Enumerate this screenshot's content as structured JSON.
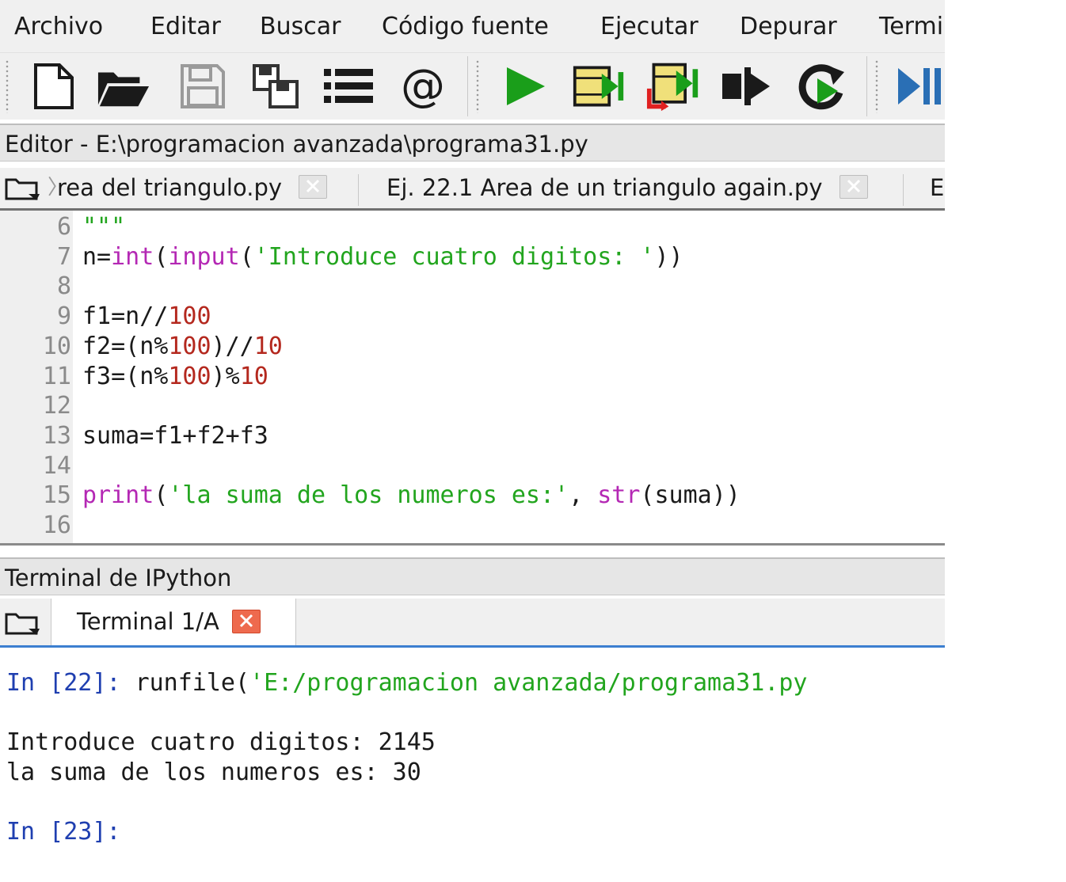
{
  "menubar": {
    "items": [
      "Archivo",
      "Editar",
      "Buscar",
      "Código fuente",
      "Ejecutar",
      "Depurar",
      "Termi"
    ]
  },
  "toolbar": {
    "buttons": [
      {
        "name": "new-file-icon"
      },
      {
        "name": "open-folder-icon"
      },
      {
        "name": "save-icon"
      },
      {
        "name": "save-all-icon"
      },
      {
        "name": "list-icon"
      },
      {
        "name": "at-icon"
      },
      {
        "name": "run-icon"
      },
      {
        "name": "run-cell-icon"
      },
      {
        "name": "run-cell-advance-icon"
      },
      {
        "name": "run-selection-icon"
      },
      {
        "name": "rerun-icon"
      },
      {
        "name": "debug-icon"
      }
    ],
    "colors": {
      "run": "#1a9e1a",
      "cell": "#f0e07a",
      "debug": "#2a6fb5"
    }
  },
  "editor": {
    "title": "Editor - E:\\programacion avanzada\\programa31.py",
    "tabs": [
      {
        "label": "rea del triangulo.py"
      },
      {
        "label": "Ej. 22.1 Area de un triangulo again.py"
      },
      {
        "label": "E"
      }
    ],
    "lines": [
      {
        "n": "6",
        "tokens": [
          {
            "t": "\"\"\"",
            "c": "cm"
          }
        ]
      },
      {
        "n": "7",
        "tokens": [
          {
            "t": "n=",
            "c": ""
          },
          {
            "t": "int",
            "c": "kw"
          },
          {
            "t": "(",
            "c": ""
          },
          {
            "t": "input",
            "c": "kw"
          },
          {
            "t": "(",
            "c": ""
          },
          {
            "t": "'Introduce cuatro digitos: '",
            "c": "str"
          },
          {
            "t": "))",
            "c": ""
          }
        ]
      },
      {
        "n": "8",
        "tokens": []
      },
      {
        "n": "9",
        "tokens": [
          {
            "t": "f1=n//",
            "c": ""
          },
          {
            "t": "100",
            "c": "num"
          }
        ]
      },
      {
        "n": "10",
        "tokens": [
          {
            "t": "f2=(n%",
            "c": ""
          },
          {
            "t": "100",
            "c": "num"
          },
          {
            "t": ")//",
            "c": ""
          },
          {
            "t": "10",
            "c": "num"
          }
        ]
      },
      {
        "n": "11",
        "tokens": [
          {
            "t": "f3=(n%",
            "c": ""
          },
          {
            "t": "100",
            "c": "num"
          },
          {
            "t": ")%",
            "c": ""
          },
          {
            "t": "10",
            "c": "num"
          }
        ]
      },
      {
        "n": "12",
        "tokens": []
      },
      {
        "n": "13",
        "tokens": [
          {
            "t": "suma=f1+f2+f3",
            "c": ""
          }
        ]
      },
      {
        "n": "14",
        "tokens": []
      },
      {
        "n": "15",
        "tokens": [
          {
            "t": "print",
            "c": "kw"
          },
          {
            "t": "(",
            "c": ""
          },
          {
            "t": "'la suma de los numeros es:'",
            "c": "str"
          },
          {
            "t": ", ",
            "c": ""
          },
          {
            "t": "str",
            "c": "kw"
          },
          {
            "t": "(suma))",
            "c": ""
          }
        ]
      },
      {
        "n": "16",
        "tokens": []
      }
    ]
  },
  "console": {
    "title": "Terminal de IPython",
    "tab_label": "Terminal 1/A",
    "lines": [
      {
        "tokens": [
          {
            "t": "In [22]: ",
            "c": "prompt"
          },
          {
            "t": "runfile(",
            "c": "tout"
          },
          {
            "t": "'E:/programacion avanzada/programa31.py",
            "c": "tstr"
          }
        ]
      },
      {
        "tokens": []
      },
      {
        "tokens": [
          {
            "t": "Introduce cuatro digitos: 2145",
            "c": "tout"
          }
        ]
      },
      {
        "tokens": [
          {
            "t": "la suma de los numeros es: 30",
            "c": "tout"
          }
        ]
      },
      {
        "tokens": []
      },
      {
        "tokens": [
          {
            "t": "In [23]:",
            "c": "prompt"
          }
        ]
      }
    ]
  }
}
